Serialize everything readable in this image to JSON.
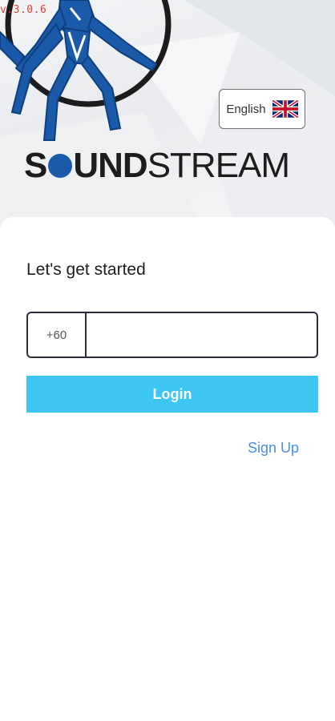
{
  "app": {
    "version": "v.3.0.6",
    "brand": {
      "s": "S",
      "und": "UND",
      "stream": "STREAM"
    }
  },
  "language": {
    "label": "English",
    "flag_icon": "uk-flag-icon"
  },
  "login": {
    "heading": "Let's get started",
    "country_code": "+60",
    "phone_value": "",
    "phone_placeholder": "",
    "login_label": "Login",
    "signup_label": "Sign Up"
  },
  "colors": {
    "accent": "#3ec6f2",
    "link": "#4a8fe0",
    "brand_blue": "#1a5aa8",
    "version_red": "#e23b3b"
  }
}
